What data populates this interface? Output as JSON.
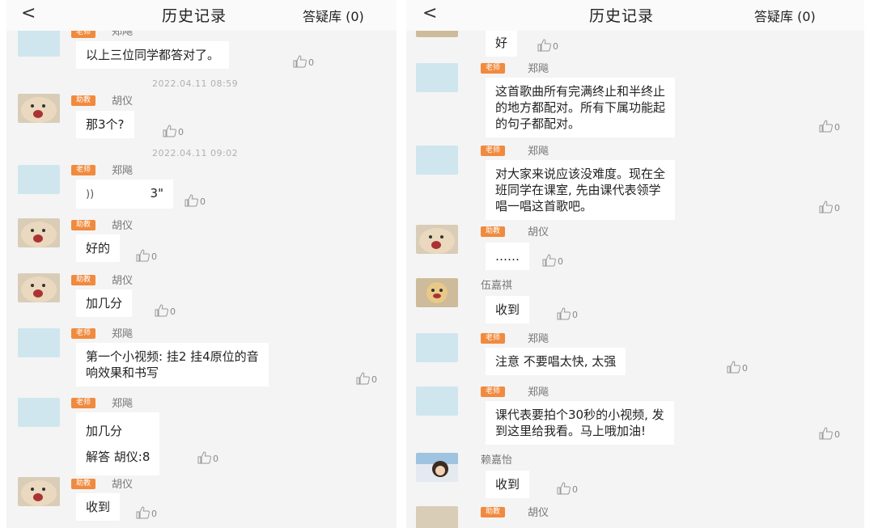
{
  "left": {
    "header": {
      "back": "<",
      "title": "历史记录",
      "qa": "答疑库 (0)"
    },
    "messages": [
      {
        "name": "郑飚",
        "role": "老师",
        "lines": [
          "以上三位同学都答对了。"
        ],
        "likes": "0"
      },
      {
        "timestamp": "2022.04.11 08:59"
      },
      {
        "name": "胡仪",
        "role": "助教",
        "lines": [
          "那3个?"
        ],
        "likes": "0"
      },
      {
        "timestamp": "2022.04.11 09:02"
      },
      {
        "name": "郑飚",
        "role": "老师",
        "voice_duration": "3\"",
        "likes": "0"
      },
      {
        "name": "胡仪",
        "role": "助教",
        "lines": [
          "好的"
        ],
        "likes": "0"
      },
      {
        "name": "胡仪",
        "role": "助教",
        "lines": [
          "加几分"
        ],
        "likes": "0"
      },
      {
        "name": "郑飚",
        "role": "老师",
        "lines": [
          "第一个小视频: 挂2 挂4原位的音",
          "响效果和书写"
        ],
        "likes": "0"
      },
      {
        "name": "郑飚",
        "role": "老师",
        "lines": [
          "加几分",
          "解答 胡仪:8"
        ],
        "likes": "0"
      },
      {
        "name": "胡仪",
        "role": "助教",
        "lines": [
          "收到"
        ],
        "likes": "0"
      }
    ]
  },
  "right": {
    "header": {
      "back": "<",
      "title": "历史记录",
      "qa": "答疑库 (0)"
    },
    "messages": [
      {
        "lines": [
          "好"
        ],
        "likes": "0"
      },
      {
        "name": "郑飚",
        "role": "老师",
        "lines": [
          "这首歌曲所有完满终止和半终止",
          "的地方都配对。所有下属功能起",
          "的句子都配对。"
        ],
        "likes": "0"
      },
      {
        "name": "郑飚",
        "role": "老师",
        "lines": [
          "对大家来说应该没难度。现在全",
          "班同学在课室, 先由课代表领学",
          "唱一唱这首歌吧。"
        ],
        "likes": "0"
      },
      {
        "name": "胡仪",
        "role": "助教",
        "lines": [
          "……"
        ],
        "likes": "0"
      },
      {
        "name": "伍嘉祺",
        "lines": [
          "收到"
        ],
        "likes": "0"
      },
      {
        "name": "郑飚",
        "role": "老师",
        "lines": [
          "注意 不要唱太快, 太强"
        ],
        "likes": "0"
      },
      {
        "name": "郑飚",
        "role": "老师",
        "lines": [
          "课代表要拍个30秒的小视频, 发",
          "到这里给我看。马上哦加油!"
        ],
        "likes": "0"
      },
      {
        "name": "赖嘉怡",
        "lines": [
          "收到"
        ],
        "likes": "0"
      },
      {
        "name": "胡仪",
        "role": "助教"
      }
    ]
  },
  "colors": {
    "badge": "#f08a3e",
    "background": "#f4f4f4",
    "bubble": "#ffffff"
  },
  "icons": [
    "back-arrow-icon",
    "thumbs-up-icon",
    "voice-icon"
  ]
}
